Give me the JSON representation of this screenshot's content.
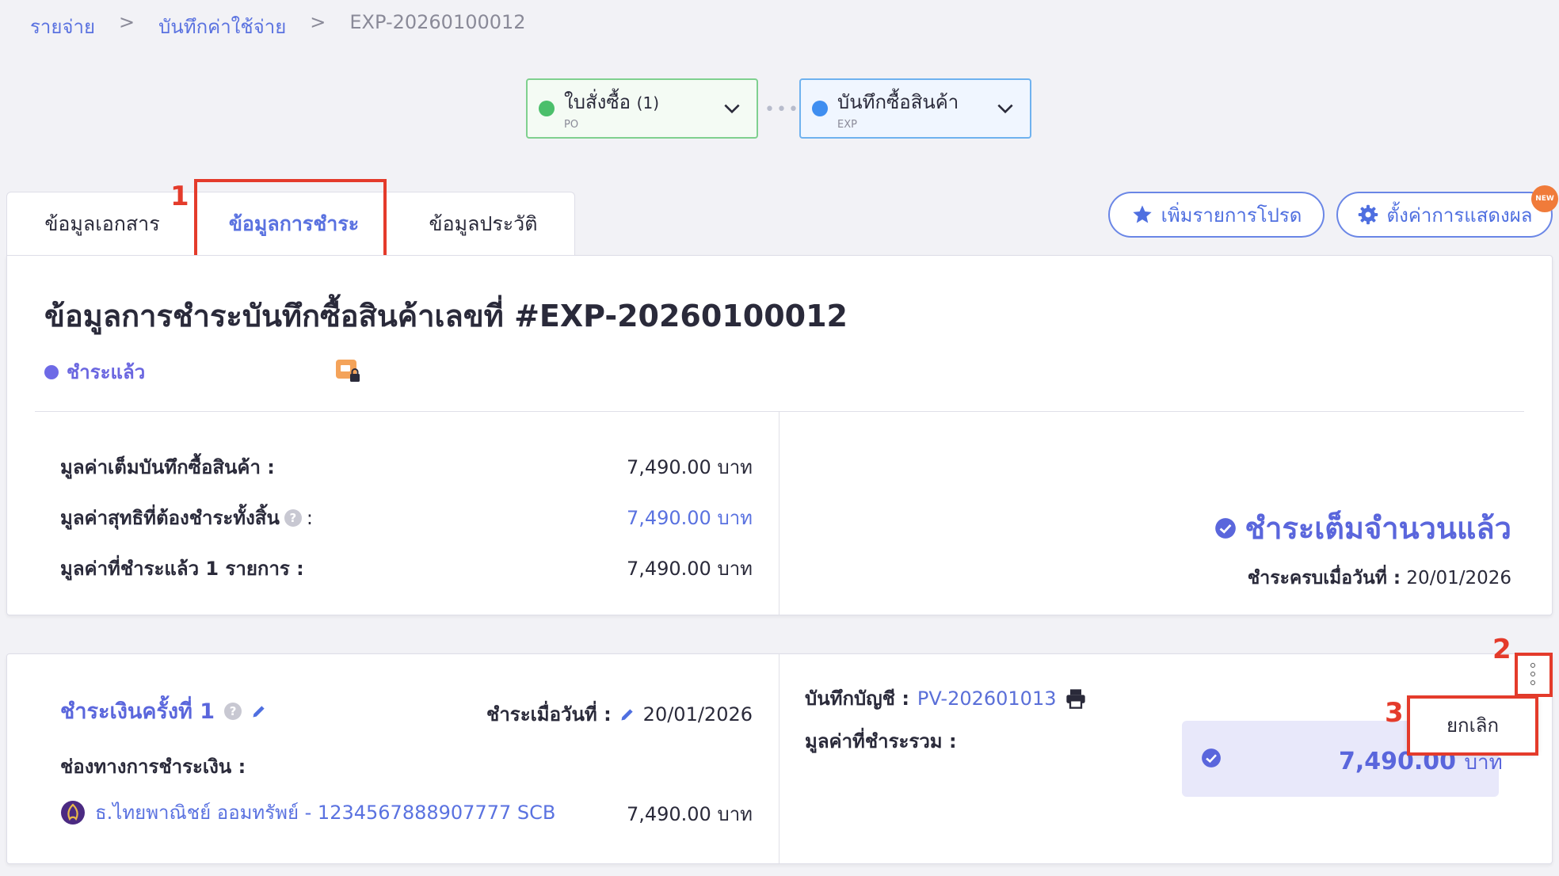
{
  "breadcrumb": {
    "items": [
      "รายจ่าย",
      "บันทึกค่าใช้จ่าย",
      "EXP-20260100012"
    ],
    "separator": ">"
  },
  "flow": {
    "po": {
      "label": "ใบสั่งซื้อ",
      "count": "(1)",
      "sub": "PO",
      "color": "#4bbf6b"
    },
    "connector": "•••",
    "exp": {
      "label": "บันทึกซื้อสินค้า",
      "sub": "EXP",
      "color": "#3f8ef0"
    }
  },
  "tabs": [
    {
      "label": "ข้อมูลเอกสาร"
    },
    {
      "label": "ข้อมูลการชำระ",
      "active": true
    },
    {
      "label": "ข้อมูลประวัติ"
    }
  ],
  "toolbar": {
    "favorite_label": "เพิ่มรายการโปรด",
    "settings_label": "ตั้งค่าการแสดงผล",
    "new_badge": "NEW"
  },
  "annotations": [
    "1",
    "2",
    "3"
  ],
  "page": {
    "title": "ข้อมูลการชำระบันทึกซื้อสินค้าเลขที่ #EXP-20260100012",
    "status": "ชำระแล้ว"
  },
  "summary": {
    "rows": [
      {
        "label": "มูลค่าเต็มบันทึกซื้อสินค้า :",
        "value": "7,490.00 บาท"
      },
      {
        "label": "มูลค่าสุทธิที่ต้องชำระทั้งสิ้น",
        "suffix": ":",
        "value": "7,490.00 บาท"
      },
      {
        "label": "มูลค่าที่ชำระแล้ว 1 รายการ :",
        "value": "7,490.00 บาท"
      }
    ],
    "paid_full": "ชำระเต็มจำนวนแล้ว",
    "paid_date_label": "ชำระครบเมื่อวันที่ :",
    "paid_date": "20/01/2026"
  },
  "payment": {
    "title": "ชำระเงินครั้งที่ 1",
    "paid_on_label": "ชำระเมื่อวันที่ :",
    "paid_on": "20/01/2026",
    "channel_label": "ช่องทางการชำระเงิน :",
    "bank": "ธ.ไทยพาณิชย์ ออมทรัพย์ - 1234567888907777 SCB",
    "bank_amount": "7,490.00 บาท",
    "account_label": "บันทึกบัญชี :",
    "account_no": "PV-202601013",
    "total_label": "มูลค่าที่ชำระรวม :",
    "total_amount": "7,490.00",
    "total_unit": "บาท",
    "cancel_label": "ยกเลิก"
  }
}
